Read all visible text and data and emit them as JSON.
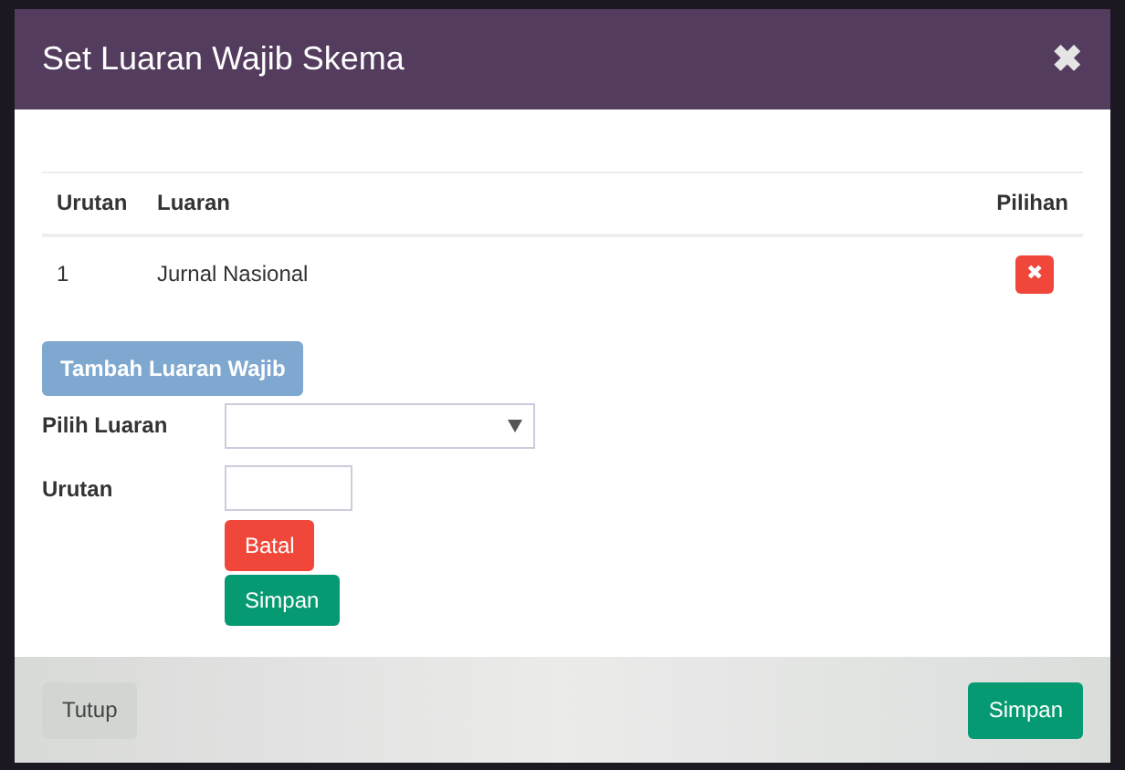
{
  "modal": {
    "title": "Set Luaran Wajib Skema",
    "close_symbol": "✖"
  },
  "table": {
    "columns": [
      "Urutan",
      "Luaran",
      "Pilihan"
    ],
    "rows": [
      {
        "urutan": "1",
        "luaran": "Jurnal Nasional",
        "delete_symbol": "✖"
      }
    ]
  },
  "add_button": {
    "label": "Tambah Luaran Wajib",
    "disabled": true
  },
  "form": {
    "select": {
      "label": "Pilih Luaran"
    },
    "order": {
      "label": "Urutan"
    },
    "buttons": [
      {
        "label": "Batal",
        "kind": "danger"
      },
      {
        "label": "Simpan",
        "kind": "success"
      }
    ]
  },
  "footer": {
    "buttons": [
      {
        "label": "Tutup",
        "kind": "default"
      },
      {
        "label": "Simpan",
        "kind": "success"
      }
    ]
  }
}
